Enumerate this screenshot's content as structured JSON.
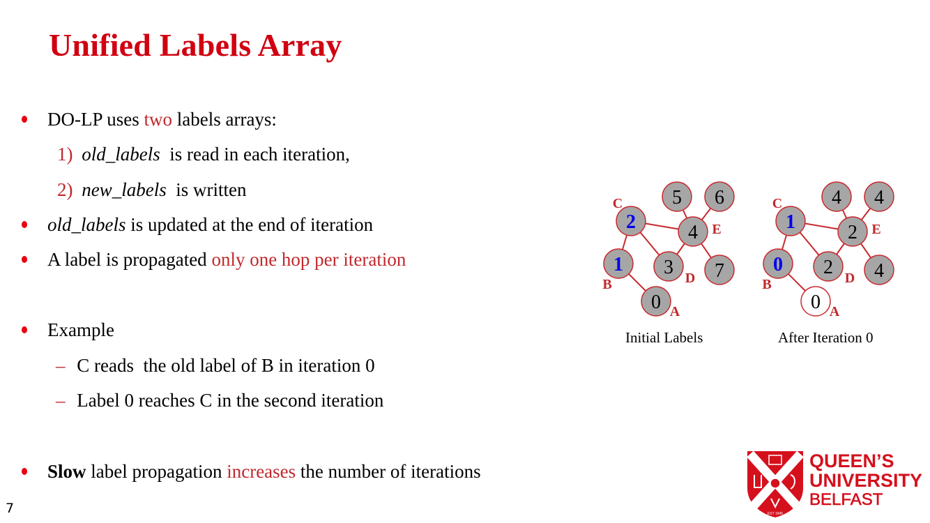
{
  "slide": {
    "title": "Unified Labels Array",
    "page_number": "7"
  },
  "bullets": {
    "b1": {
      "pre": "DO-LP uses ",
      "highlight": "two",
      "post": " labels arrays:"
    },
    "b1_sub1": {
      "num": "1)",
      "italic": "old_labels",
      "post": "  is read in each iteration,"
    },
    "b1_sub2": {
      "num": "2)",
      "italic": "new_labels",
      "post": "  is written"
    },
    "b2": {
      "italic": "old_labels",
      "post": " is updated at the end of iteration"
    },
    "b3": {
      "pre": "A label is propagated ",
      "highlight": "only one hop per iteration"
    },
    "b4": {
      "text": "Example"
    },
    "b4_sub1": {
      "dash": "–",
      "text": "C reads  the old label of B in iteration 0"
    },
    "b4_sub2": {
      "dash": "–",
      "text": "Label 0 reaches C in the second iteration"
    },
    "b5": {
      "bold": "Slow",
      "pre": " label propagation ",
      "highlight": "increases",
      "post": " the number of iterations"
    }
  },
  "diagram": {
    "colors": {
      "node_fill": "#a6a6a6",
      "node_stroke": "#c8282d",
      "edge": "#c8282d",
      "letter": "#c0282d",
      "highlight_label": "#0000ee",
      "visited_fill": "#ffffff"
    },
    "nodes": [
      "A",
      "B",
      "C",
      "D",
      "E",
      "n5",
      "n6",
      "n7"
    ],
    "edges": [
      [
        "A",
        "B"
      ],
      [
        "B",
        "C"
      ],
      [
        "C",
        "D"
      ],
      [
        "C",
        "E"
      ],
      [
        "D",
        "E"
      ],
      [
        "E",
        "n5"
      ],
      [
        "E",
        "n6"
      ],
      [
        "E",
        "n7"
      ]
    ],
    "vertex_letters": {
      "A": "A",
      "B": "B",
      "C": "C",
      "D": "D",
      "E": "E"
    },
    "panels": [
      {
        "caption": "Initial Labels",
        "labels": {
          "A": "0",
          "B": "1",
          "C": "2",
          "D": "3",
          "E": "4",
          "n5": "5",
          "n6": "6",
          "n7": "7"
        },
        "highlighted": [
          "B",
          "C"
        ],
        "white_nodes": []
      },
      {
        "caption": "After Iteration 0",
        "labels": {
          "A": "0",
          "B": "0",
          "C": "1",
          "D": "2",
          "E": "2",
          "n5": "4",
          "n6": "4",
          "n7": "4"
        },
        "highlighted": [
          "B",
          "C"
        ],
        "white_nodes": [
          "A"
        ]
      }
    ]
  },
  "logo": {
    "line1": "QUEEN’S",
    "line2": "UNIVERSITY",
    "line3": "BELFAST",
    "crest_motto": "EST 1845",
    "brand_color": "#d5101d"
  }
}
